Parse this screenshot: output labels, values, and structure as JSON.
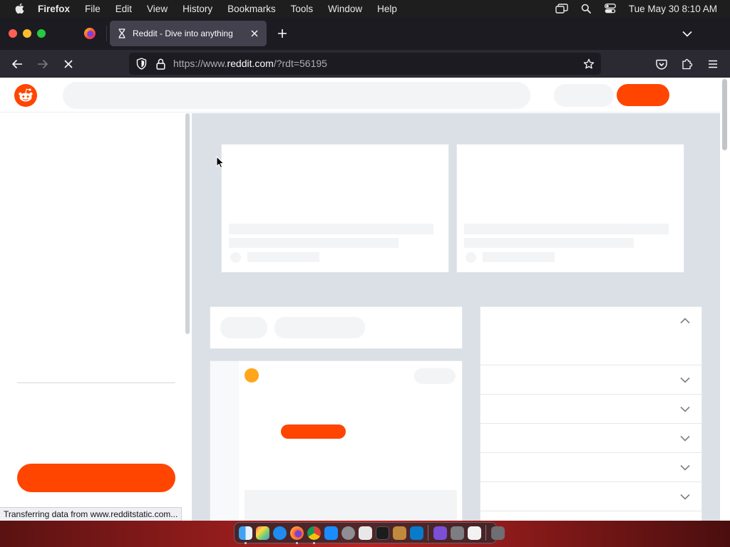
{
  "menubar": {
    "app_name": "Firefox",
    "menus": [
      "File",
      "Edit",
      "View",
      "History",
      "Bookmarks",
      "Tools",
      "Window",
      "Help"
    ],
    "clock": "Tue May 30  8:10 AM"
  },
  "browser": {
    "active_tab_title": "Reddit - Dive into anything",
    "url_prefix": "https://www.",
    "url_host": "reddit.com",
    "url_path": "/?rdt=56195",
    "status_text": "Transferring data from www.redditstatic.com..."
  },
  "colors": {
    "reddit_orange": "#ff4500",
    "skeleton": "#f3f4f6",
    "page_bg": "#dae0e6"
  },
  "dock": {
    "items": [
      "finder-icon",
      "launchpad-icon",
      "safari-icon",
      "firefox-icon",
      "chrome-icon",
      "app-store-icon",
      "system-settings-icon",
      "script-editor-icon",
      "terminal-icon",
      "paintbrush-icon",
      "vscode-icon",
      "visual-studio-icon",
      "preview-icon",
      "textedit-icon",
      "trash-icon"
    ]
  }
}
